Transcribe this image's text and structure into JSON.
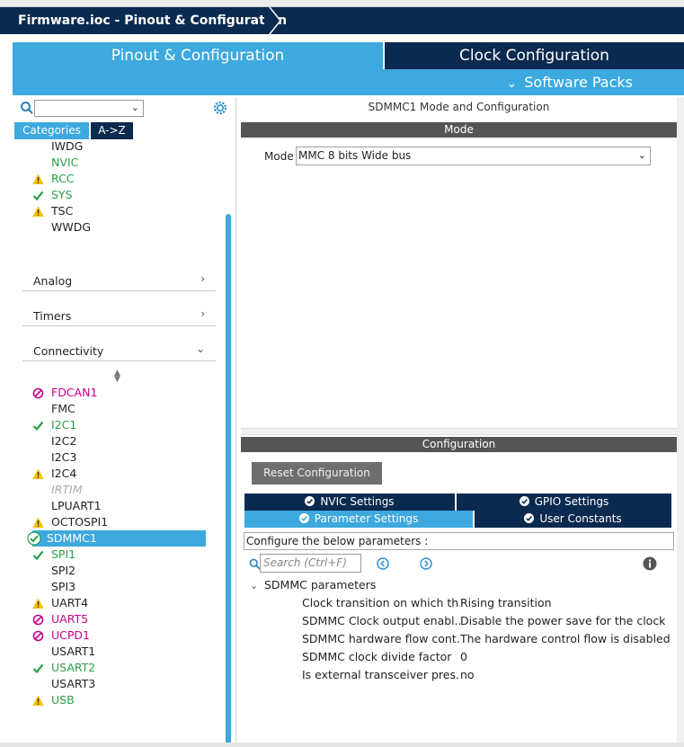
{
  "window": {
    "breadcrumb": "Firmware.ioc - Pinout & Configuration"
  },
  "tabs": {
    "pinout": "Pinout & Configuration",
    "clock": "Clock Configuration",
    "software_packs": "Software Packs"
  },
  "left": {
    "category_tab": "Categories",
    "az_tab": "A->Z",
    "top_items": [
      {
        "label": "IWDG",
        "status": "none",
        "color": "gray"
      },
      {
        "label": "NVIC",
        "status": "none",
        "color": "green"
      },
      {
        "label": "RCC",
        "status": "warning",
        "color": "green"
      },
      {
        "label": "SYS",
        "status": "check",
        "color": "green"
      },
      {
        "label": "TSC",
        "status": "warning",
        "color": "gray"
      },
      {
        "label": "WWDG",
        "status": "none",
        "color": "gray"
      }
    ],
    "sections": {
      "analog": "Analog",
      "timers": "Timers",
      "connectivity": "Connectivity"
    },
    "connectivity_items": [
      {
        "label": "FDCAN1",
        "status": "disabled",
        "color": "magenta"
      },
      {
        "label": "FMC",
        "status": "none",
        "color": "gray"
      },
      {
        "label": "I2C1",
        "status": "check",
        "color": "green"
      },
      {
        "label": "I2C2",
        "status": "none",
        "color": "gray"
      },
      {
        "label": "I2C3",
        "status": "none",
        "color": "gray"
      },
      {
        "label": "I2C4",
        "status": "warning",
        "color": "gray"
      },
      {
        "label": "IRTIM",
        "status": "none",
        "color": "italic"
      },
      {
        "label": "LPUART1",
        "status": "none",
        "color": "gray"
      },
      {
        "label": "OCTOSPI1",
        "status": "warning",
        "color": "gray"
      },
      {
        "label": "SDMMC1",
        "status": "selected",
        "color": "white"
      },
      {
        "label": "SPI1",
        "status": "check",
        "color": "green"
      },
      {
        "label": "SPI2",
        "status": "none",
        "color": "gray"
      },
      {
        "label": "SPI3",
        "status": "none",
        "color": "gray"
      },
      {
        "label": "UART4",
        "status": "warning",
        "color": "gray"
      },
      {
        "label": "UART5",
        "status": "disabled",
        "color": "magenta"
      },
      {
        "label": "UCPD1",
        "status": "disabled",
        "color": "magenta"
      },
      {
        "label": "USART1",
        "status": "none",
        "color": "gray"
      },
      {
        "label": "USART2",
        "status": "check",
        "color": "green"
      },
      {
        "label": "USART3",
        "status": "none",
        "color": "gray"
      },
      {
        "label": "USB",
        "status": "warning",
        "color": "green"
      }
    ]
  },
  "right": {
    "title": "SDMMC1 Mode and Configuration",
    "mode_header": "Mode",
    "mode_label": "Mode",
    "mode_value": "MMC 8 bits Wide bus",
    "config_header": "Configuration",
    "reset_button": "Reset Configuration",
    "settings_tabs": {
      "nvic": "NVIC Settings",
      "gpio": "GPIO Settings",
      "parameter": "Parameter Settings",
      "user_constants": "User Constants"
    },
    "hint": "Configure the below parameters :",
    "search_placeholder": "Search (Ctrl+F)",
    "group_title": "SDMMC parameters",
    "parameters": [
      {
        "name": "Clock transition on which th...",
        "value": "Rising transition"
      },
      {
        "name": "SDMMC Clock output enabl...",
        "value": "Disable the power save for the clock"
      },
      {
        "name": "SDMMC hardware flow cont...",
        "value": "The hardware control flow is disabled"
      },
      {
        "name": "SDMMC clock divide factor",
        "value": "0"
      },
      {
        "name": "Is external transceiver pres...",
        "value": "no"
      }
    ]
  },
  "colors": {
    "navy": "#0b2a4f",
    "accent_blue": "#3da9de",
    "green": "#2aa04a",
    "magenta": "#c7008a",
    "warning": "#f5c400",
    "header_gray": "#555555"
  }
}
